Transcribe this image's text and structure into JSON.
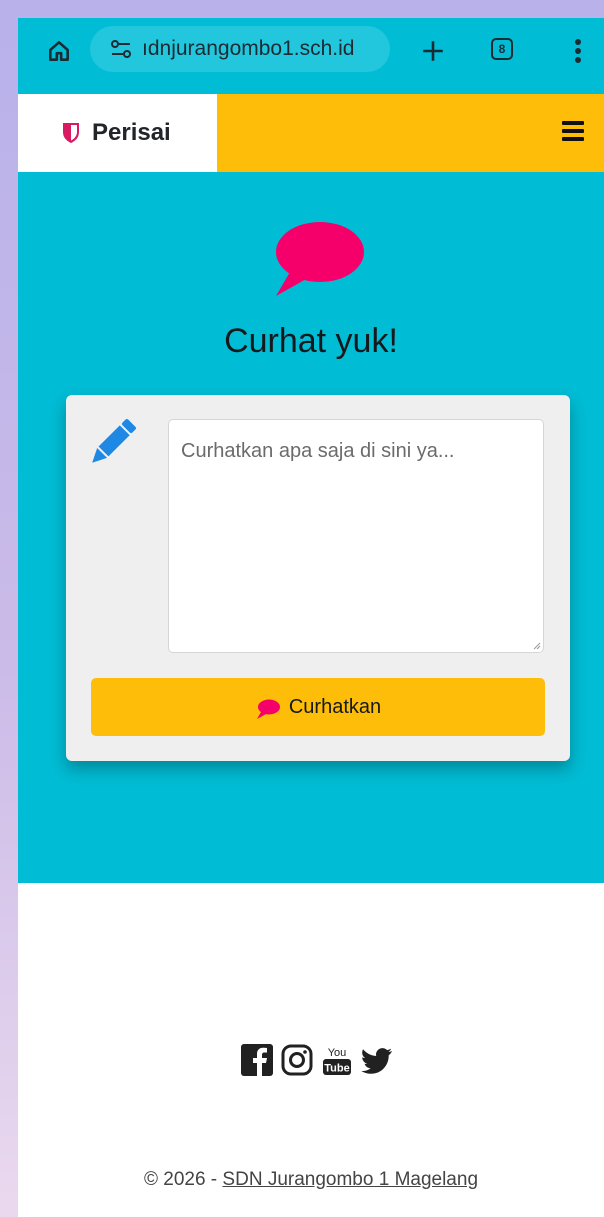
{
  "browser": {
    "url": "ıdnjurangombo1.sch.id",
    "tab_count": "8",
    "icons": [
      "home-icon",
      "site-settings-icon",
      "new-tab-icon",
      "tab-switcher-icon",
      "more-options-icon"
    ]
  },
  "navbar": {
    "brand": "Perisai",
    "brand_icon": "shield-icon",
    "menu_icon": "hamburger-menu-icon"
  },
  "hero": {
    "icon": "speech-bubble-icon",
    "title": "Curhat yuk!"
  },
  "form": {
    "placeholder": "Curhatkan apa saja di sini ya...",
    "value": "",
    "field_icon": "pencil-icon",
    "submit_label": "Curhatkan",
    "submit_icon": "speech-bubble-icon"
  },
  "footer": {
    "social": [
      "facebook-icon",
      "instagram-icon",
      "youtube-icon",
      "twitter-icon"
    ],
    "copyright_prefix": "© 2026 - ",
    "copyright_link": "SDN Jurangombo 1 Magelang"
  },
  "colors": {
    "accent_cyan": "#00bcd4",
    "accent_yellow": "#fdbd08",
    "bubble_pink": "#f5006b",
    "pencil_blue": "#1e88e5"
  }
}
